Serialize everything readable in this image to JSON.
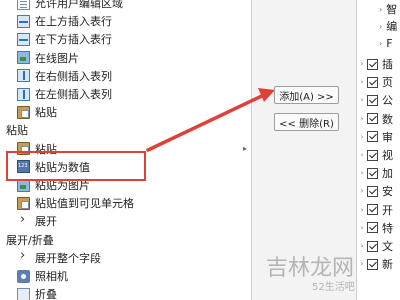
{
  "left_menu": {
    "items": [
      {
        "label": "允许用户编辑区域",
        "icon": "document-icon",
        "kind": "item"
      },
      {
        "label": "在上方插入表行",
        "icon": "insert-row-icon",
        "kind": "item"
      },
      {
        "label": "在下方插入表行",
        "icon": "insert-row-icon",
        "kind": "item"
      },
      {
        "label": "在线图片",
        "icon": "picture-icon",
        "kind": "item"
      },
      {
        "label": "在右侧插入表列",
        "icon": "insert-column-icon",
        "kind": "item"
      },
      {
        "label": "在左侧插入表列",
        "icon": "insert-column-icon",
        "kind": "item"
      },
      {
        "label": "粘贴",
        "icon": "paste-icon",
        "kind": "item"
      },
      {
        "label": "粘贴",
        "kind": "section"
      },
      {
        "label": "粘贴",
        "icon": "paste-icon",
        "kind": "item",
        "has_submenu": true
      },
      {
        "label": "粘贴为数值",
        "icon": "paste-values-icon",
        "kind": "item",
        "highlighted": true
      },
      {
        "label": "粘贴为图片",
        "icon": "paste-picture-icon",
        "kind": "item"
      },
      {
        "label": "粘贴值到可见单元格",
        "icon": "paste-icon",
        "kind": "item"
      },
      {
        "label": "展开",
        "icon": "expand-icon",
        "kind": "item"
      },
      {
        "label": "展开/折叠",
        "kind": "section"
      },
      {
        "label": "展开整个字段",
        "icon": "expand-icon",
        "kind": "item"
      },
      {
        "label": "照相机",
        "icon": "camera-icon",
        "kind": "item"
      },
      {
        "label": "折叠",
        "icon": "collapse-icon",
        "kind": "item"
      }
    ]
  },
  "buttons": {
    "add": "添加(A) >>",
    "remove": "<< 删除(R)"
  },
  "right_tree": {
    "top_items": [
      "智",
      "编",
      "F"
    ],
    "checked_items": [
      "插",
      "页",
      "公",
      "数",
      "审",
      "视",
      "加",
      "安",
      "开",
      "特",
      "文",
      "新"
    ]
  },
  "watermark": {
    "text": "吉林龙网",
    "url": "52生活吧"
  },
  "colors": {
    "highlight_border": "#e0403a",
    "arrow": "#e0403a"
  }
}
